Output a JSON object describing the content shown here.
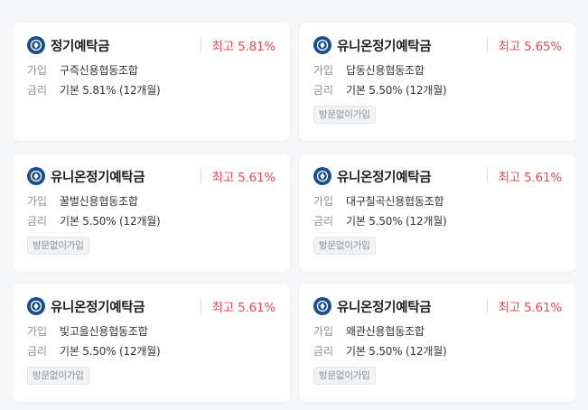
{
  "labels": {
    "join": "가입",
    "rate": "금리"
  },
  "products": [
    {
      "name": "정기예탁금",
      "max_rate": "최고 5.81%",
      "institution": "구즉신용협동조합",
      "base_rate": "기본 5.81% (12개월)",
      "badge": ""
    },
    {
      "name": "유니온정기예탁금",
      "max_rate": "최고 5.65%",
      "institution": "답동신용협동조합",
      "base_rate": "기본 5.50% (12개월)",
      "badge": "방문없이가입"
    },
    {
      "name": "유니온정기예탁금",
      "max_rate": "최고 5.61%",
      "institution": "꿀벌신용협동조합",
      "base_rate": "기본 5.50% (12개월)",
      "badge": "방문없이가입"
    },
    {
      "name": "유니온정기예탁금",
      "max_rate": "최고 5.61%",
      "institution": "대구칠곡신용협동조합",
      "base_rate": "기본 5.50% (12개월)",
      "badge": "방문없이가입"
    },
    {
      "name": "유니온정기예탁금",
      "max_rate": "최고 5.61%",
      "institution": "빛고을신용협동조합",
      "base_rate": "기본 5.50% (12개월)",
      "badge": "방문없이가입"
    },
    {
      "name": "유니온정기예탁금",
      "max_rate": "최고 5.61%",
      "institution": "왜관신용협동조합",
      "base_rate": "기본 5.50% (12개월)",
      "badge": "방문없이가입"
    }
  ],
  "colors": {
    "accent_rate": "#e5484d",
    "logo_bg": "#1c4e8a"
  },
  "icons": {
    "logo": "credit-union-logo-icon"
  }
}
